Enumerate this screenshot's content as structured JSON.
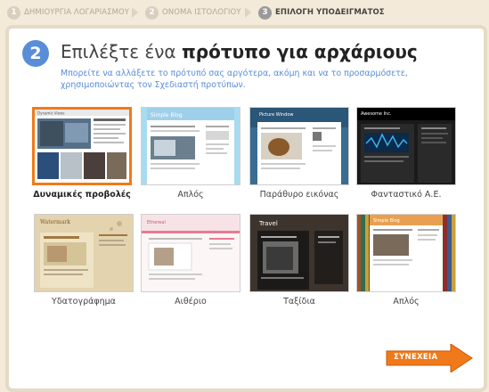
{
  "steps": [
    {
      "num": "1",
      "label": "ΔΗΜΙΟΥΡΓΙΑ ΛΟΓΑΡΙΑΣΜΟΥ"
    },
    {
      "num": "2",
      "label": "ΟΝΟΜΑ ΙΣΤΟΛΟΓΙΟΥ"
    },
    {
      "num": "3",
      "label": "ΕΠΙΛΟΓΗ ΥΠΟΔΕΙΓΜΑΤΟΣ"
    }
  ],
  "header": {
    "step_number": "2",
    "title_prefix": "Επιλέξτε ένα ",
    "title_bold": "πρότυπο για αρχάριους",
    "subtitle": "Μπορείτε να αλλάξετε το πρότυπό σας αργότερα, ακόμη και να το προσαρμόσετε, χρησιμοποιώντας τον Σχεδιαστή προτύπων."
  },
  "templates": [
    {
      "label": "Δυναμικές προβολές",
      "selected": true,
      "thumb_title": "Dynamic Views"
    },
    {
      "label": "Απλός",
      "selected": false,
      "thumb_title": "Simple Blog"
    },
    {
      "label": "Παράθυρο εικόνας",
      "selected": false,
      "thumb_title": "Picture Window"
    },
    {
      "label": "Φανταστικό Α.Ε.",
      "selected": false,
      "thumb_title": "Awesome Inc."
    },
    {
      "label": "Υδατογράφημα",
      "selected": false,
      "thumb_title": "Watermark"
    },
    {
      "label": "Αιθέριο",
      "selected": false,
      "thumb_title": "Ethereal"
    },
    {
      "label": "Ταξίδια",
      "selected": false,
      "thumb_title": "Travel"
    },
    {
      "label": "Απλός",
      "selected": false,
      "thumb_title": "Simple Blog"
    }
  ],
  "continue_label": "ΣΥΝΕΧΕΙΑ",
  "colors": {
    "accent": "#5a8dd8",
    "selected_border": "#f07a1a",
    "button": "#f07a1a"
  }
}
